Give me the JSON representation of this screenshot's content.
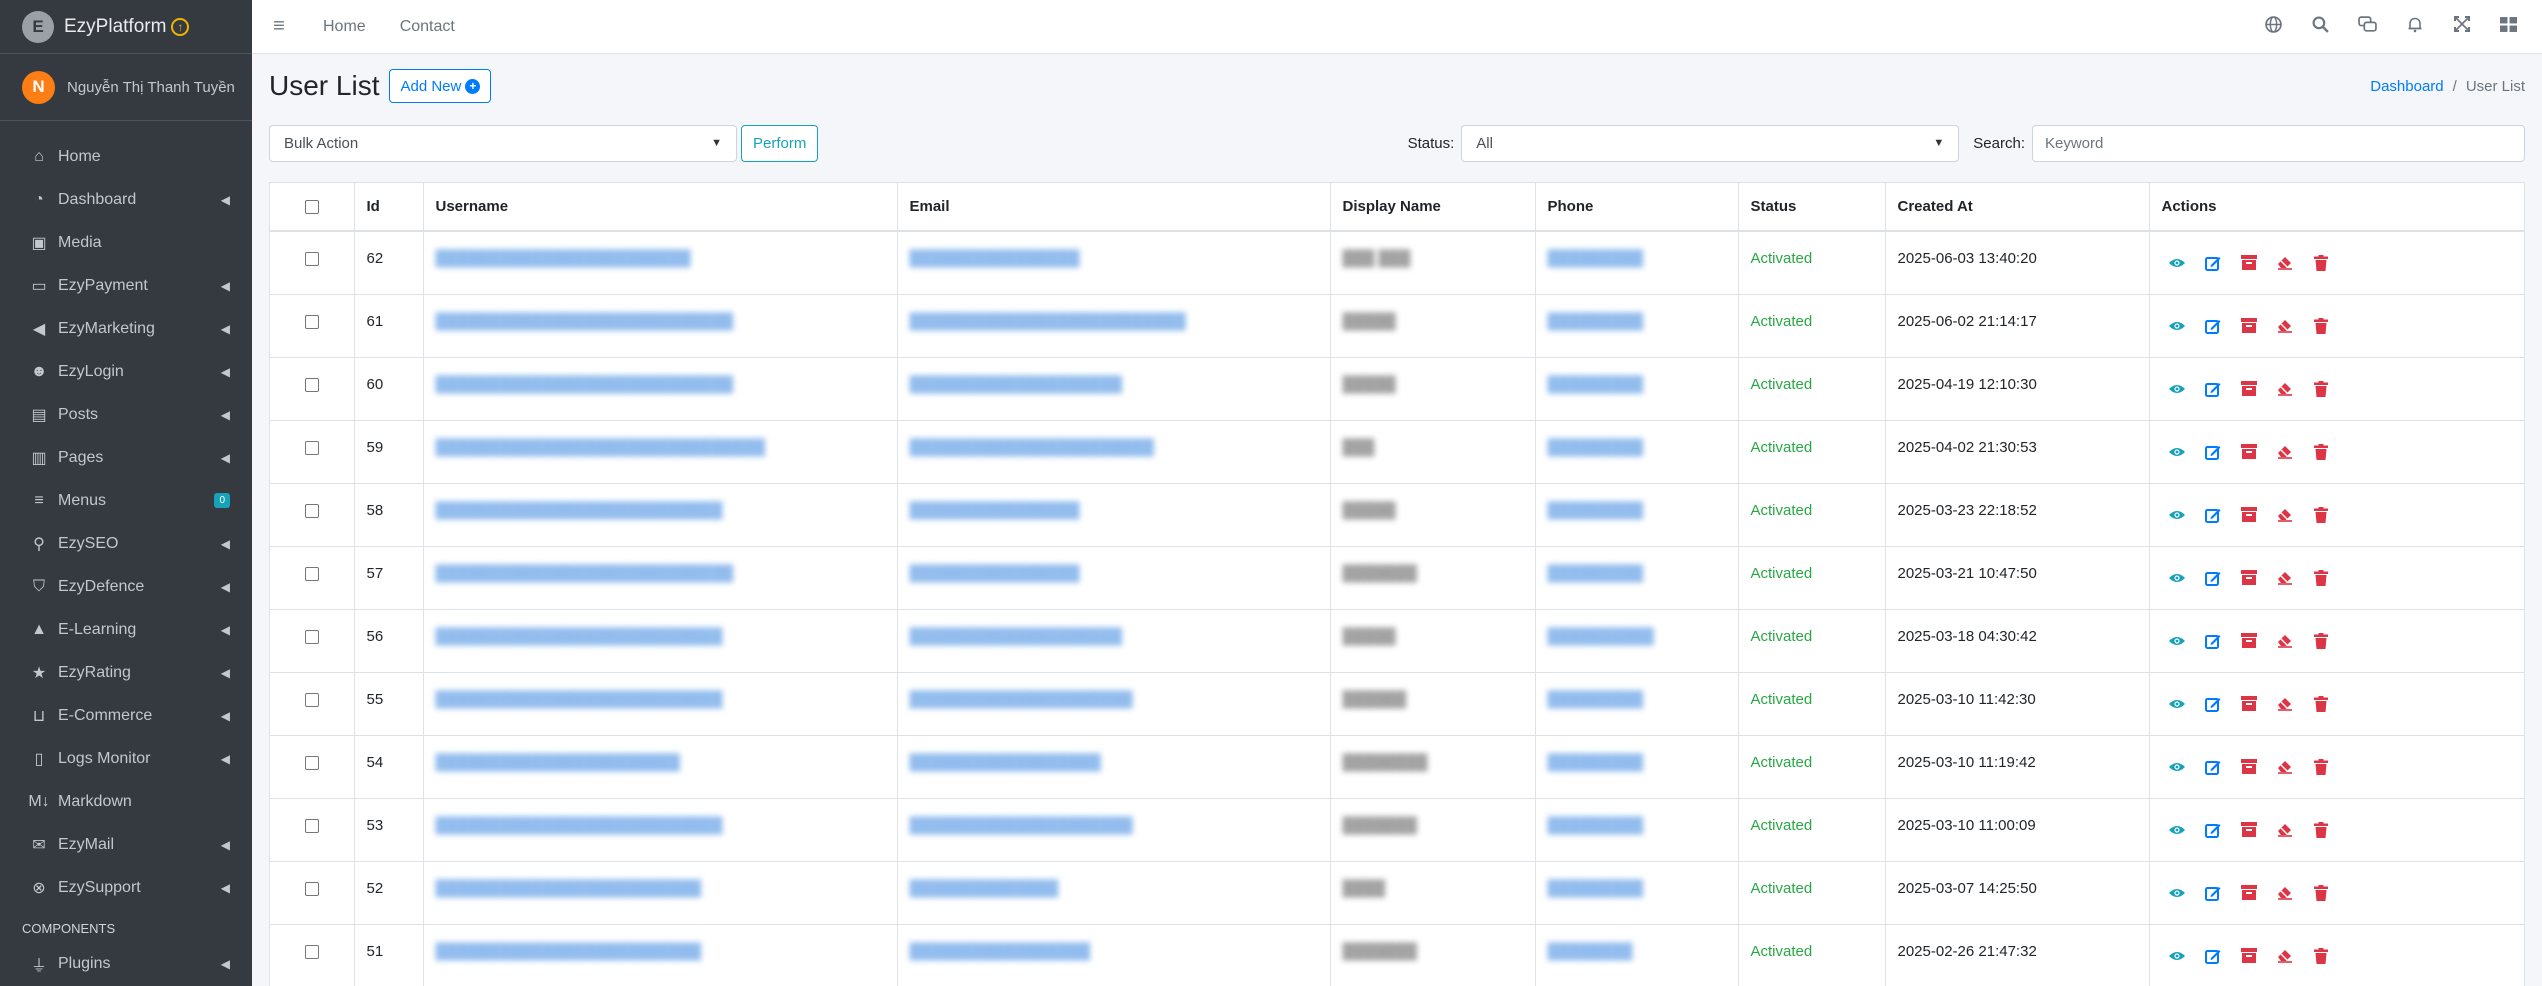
{
  "brand": {
    "name": "EzyPlatform",
    "logo_letter": "E"
  },
  "user": {
    "initial": "N",
    "name": "Nguyễn Thị Thanh Tuyền"
  },
  "sidebar": {
    "items": [
      {
        "label": "Home",
        "icon": "home-icon",
        "arrow": false
      },
      {
        "label": "Dashboard",
        "icon": "dashboard-icon",
        "arrow": true
      },
      {
        "label": "Media",
        "icon": "image-icon",
        "arrow": false
      },
      {
        "label": "EzyPayment",
        "icon": "wallet-icon",
        "arrow": true
      },
      {
        "label": "EzyMarketing",
        "icon": "megaphone-icon",
        "arrow": true
      },
      {
        "label": "EzyLogin",
        "icon": "users-icon",
        "arrow": true
      },
      {
        "label": "Posts",
        "icon": "posts-icon",
        "arrow": true
      },
      {
        "label": "Pages",
        "icon": "pages-icon",
        "arrow": true
      },
      {
        "label": "Menus",
        "icon": "bars-icon",
        "arrow": false,
        "badge": "0"
      },
      {
        "label": "EzySEO",
        "icon": "seo-icon",
        "arrow": true
      },
      {
        "label": "EzyDefence",
        "icon": "shield-icon",
        "arrow": true
      },
      {
        "label": "E-Learning",
        "icon": "graduation-cap-icon",
        "arrow": true
      },
      {
        "label": "EzyRating",
        "icon": "star-icon",
        "arrow": true
      },
      {
        "label": "E-Commerce",
        "icon": "basket-icon",
        "arrow": true
      },
      {
        "label": "Logs Monitor",
        "icon": "file-icon",
        "arrow": true
      },
      {
        "label": "Markdown",
        "icon": "markdown-icon",
        "arrow": false
      },
      {
        "label": "EzyMail",
        "icon": "envelope-icon",
        "arrow": true
      },
      {
        "label": "EzySupport",
        "icon": "support-icon",
        "arrow": true
      }
    ],
    "section_header": "COMPONENTS",
    "plugins_label": "Plugins"
  },
  "navbar": {
    "links": [
      "Home",
      "Contact"
    ],
    "right_icons": [
      "globe-icon",
      "search-icon",
      "chat-icon",
      "bell-icon",
      "expand-icon",
      "apps-icon"
    ]
  },
  "page": {
    "title": "User List",
    "add_label": "Add New",
    "breadcrumb": {
      "link": "Dashboard",
      "active": "User List"
    }
  },
  "filters": {
    "bulk_action": "Bulk Action",
    "perform_label": "Perform",
    "status_label": "Status:",
    "status_value": "All",
    "search_label": "Search:",
    "search_placeholder": "Keyword"
  },
  "table": {
    "headers": [
      "Id",
      "Username",
      "Email",
      "Display Name",
      "Phone",
      "Status",
      "Created At",
      "Actions"
    ],
    "rows": [
      {
        "id": "62",
        "username": "████████████████████████",
        "email": "████████████████",
        "display": "███ ███",
        "phone": "█████████",
        "status": "Activated",
        "created": "2025-06-03 13:40:20"
      },
      {
        "id": "61",
        "username": "████████████████████████████",
        "email": "██████████████████████████",
        "display": "█████",
        "phone": "█████████",
        "status": "Activated",
        "created": "2025-06-02 21:14:17"
      },
      {
        "id": "60",
        "username": "████████████████████████████",
        "email": "████████████████████",
        "display": "█████",
        "phone": "█████████",
        "status": "Activated",
        "created": "2025-04-19 12:10:30"
      },
      {
        "id": "59",
        "username": "███████████████████████████████",
        "email": "███████████████████████",
        "display": "███",
        "phone": "█████████",
        "status": "Activated",
        "created": "2025-04-02 21:30:53"
      },
      {
        "id": "58",
        "username": "███████████████████████████",
        "email": "████████████████",
        "display": "█████",
        "phone": "█████████",
        "status": "Activated",
        "created": "2025-03-23 22:18:52"
      },
      {
        "id": "57",
        "username": "████████████████████████████",
        "email": "████████████████",
        "display": "███████",
        "phone": "█████████",
        "status": "Activated",
        "created": "2025-03-21 10:47:50"
      },
      {
        "id": "56",
        "username": "███████████████████████████",
        "email": "████████████████████",
        "display": "█████",
        "phone": "██████████",
        "status": "Activated",
        "created": "2025-03-18 04:30:42"
      },
      {
        "id": "55",
        "username": "███████████████████████████",
        "email": "█████████████████████",
        "display": "██████",
        "phone": "█████████",
        "status": "Activated",
        "created": "2025-03-10 11:42:30"
      },
      {
        "id": "54",
        "username": "███████████████████████",
        "email": "██████████████████",
        "display": "████████",
        "phone": "█████████",
        "status": "Activated",
        "created": "2025-03-10 11:19:42"
      },
      {
        "id": "53",
        "username": "███████████████████████████",
        "email": "█████████████████████",
        "display": "███████",
        "phone": "█████████",
        "status": "Activated",
        "created": "2025-03-10 11:00:09"
      },
      {
        "id": "52",
        "username": "█████████████████████████",
        "email": "██████████████",
        "display": "████",
        "phone": "█████████",
        "status": "Activated",
        "created": "2025-03-07 14:25:50"
      },
      {
        "id": "51",
        "username": "█████████████████████████",
        "email": "█████████████████",
        "display": "███████",
        "phone": "████████",
        "status": "Activated",
        "created": "2025-02-26 21:47:32"
      }
    ],
    "action_icons": [
      "view-icon",
      "edit-icon",
      "archive-icon",
      "erase-icon",
      "delete-icon"
    ]
  },
  "colors": {
    "sidebar_bg": "#343a40",
    "primary": "#007bff",
    "info": "#17a2b8",
    "success": "#28a745",
    "danger": "#dc3545"
  }
}
